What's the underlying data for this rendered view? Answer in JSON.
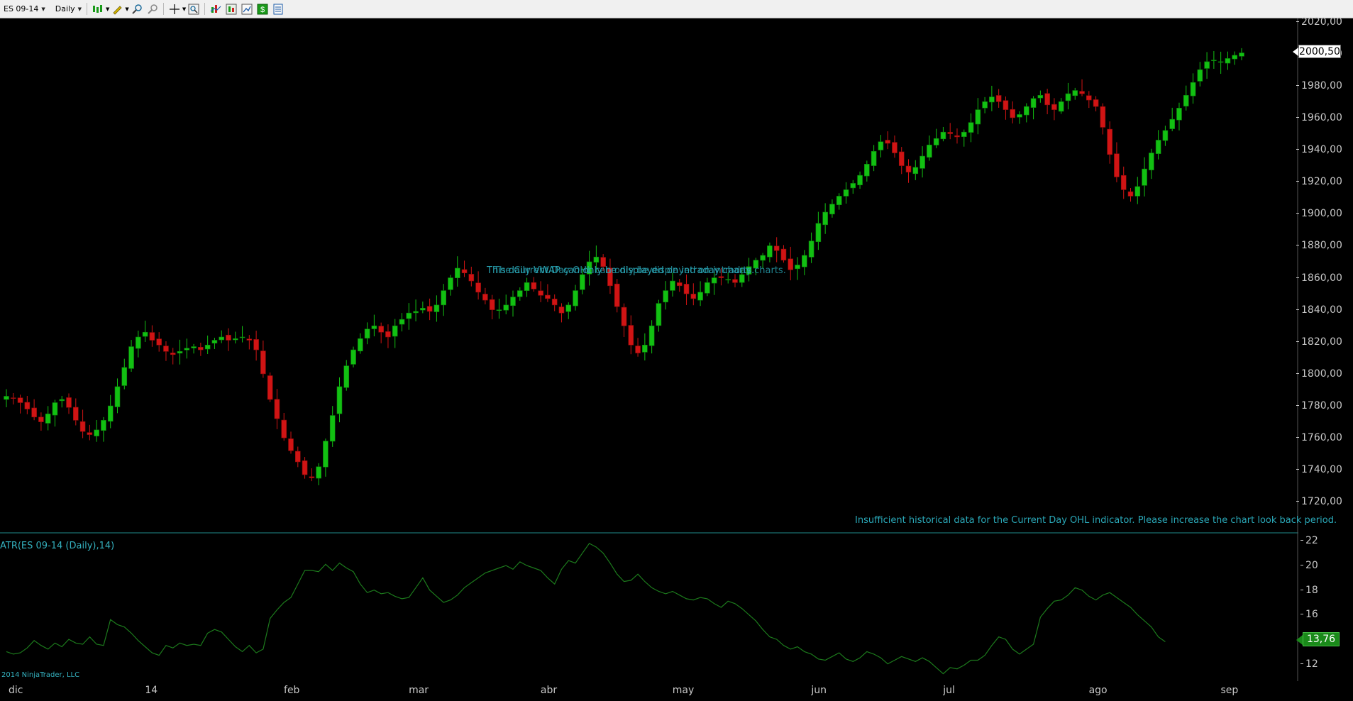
{
  "toolbar": {
    "instrument": "ES 09-14",
    "period": "Daily",
    "icons": [
      "bar-type-icon",
      "draw-pencil-icon",
      "zoom-in-icon",
      "zoom-out-icon",
      "crosshair-icon",
      "magnifier-icon",
      "indicators-icon",
      "strategies-icon",
      "chart-properties-icon",
      "dollar-icon",
      "data-box-icon"
    ]
  },
  "colors": {
    "background": "#000000",
    "up_candle": "#12c012",
    "down_candle": "#d01414",
    "atr_line": "#1c7a1c",
    "panel_divider": "#1f8a8a",
    "message_text": "#2aa8b8"
  },
  "price_panel": {
    "messages": {
      "vwap": "This daily VWAP can only be displayed on intraday charts.",
      "vwap_overlap": "The Current Day OHL can only be displayed on intraday charts.",
      "ohl": "Insufficient historical data for the Current Day OHL indicator. Please increase the chart look back period."
    },
    "last_price_label": "2000,50"
  },
  "indicator_panel": {
    "title": "ATR(ES 09-14 (Daily),14)",
    "last_value_label": "13,76"
  },
  "footer": {
    "copyright": "2014 NinjaTrader, LLC"
  },
  "chart_data": [
    {
      "type": "candlestick",
      "y_ticks": [
        "2020,00",
        "2000,00",
        "1980,00",
        "1960,00",
        "1940,00",
        "1920,00",
        "1900,00",
        "1880,00",
        "1860,00",
        "1840,00",
        "1820,00",
        "1800,00",
        "1780,00",
        "1760,00",
        "1740,00",
        "1720,00"
      ],
      "y_tick_values": [
        2020,
        2000,
        1980,
        1960,
        1940,
        1920,
        1900,
        1880,
        1860,
        1840,
        1820,
        1800,
        1780,
        1760,
        1740,
        1720
      ],
      "ylim": [
        1702,
        2022
      ],
      "x_tick_labels": [
        "dic",
        "14",
        "feb",
        "mar",
        "abr",
        "may",
        "jun",
        "jul",
        "ago",
        "sep"
      ],
      "x_tick_bar_index": [
        0,
        21,
        41,
        59,
        78,
        97,
        117,
        136,
        157,
        176
      ],
      "close_series": [
        1786,
        1785,
        1782,
        1778,
        1773,
        1770,
        1775,
        1782,
        1784,
        1779,
        1771,
        1764,
        1762,
        1765,
        1771,
        1780,
        1792,
        1804,
        1817,
        1823,
        1826,
        1821,
        1818,
        1814,
        1812,
        1814,
        1816,
        1817,
        1815,
        1818,
        1821,
        1823,
        1821,
        1822,
        1823,
        1821,
        1815,
        1800,
        1784,
        1772,
        1760,
        1752,
        1745,
        1737,
        1735,
        1742,
        1758,
        1774,
        1792,
        1805,
        1815,
        1822,
        1828,
        1830,
        1826,
        1823,
        1830,
        1834,
        1838,
        1839,
        1841,
        1839,
        1843,
        1852,
        1860,
        1866,
        1863,
        1858,
        1851,
        1846,
        1840,
        1840,
        1843,
        1848,
        1852,
        1857,
        1853,
        1849,
        1847,
        1843,
        1838,
        1843,
        1852,
        1862,
        1870,
        1873,
        1867,
        1855,
        1842,
        1830,
        1818,
        1813,
        1818,
        1830,
        1844,
        1852,
        1858,
        1855,
        1850,
        1847,
        1851,
        1857,
        1860,
        1860,
        1859,
        1857,
        1862,
        1867,
        1871,
        1874,
        1880,
        1877,
        1871,
        1865,
        1868,
        1874,
        1883,
        1894,
        1901,
        1906,
        1911,
        1915,
        1919,
        1924,
        1931,
        1939,
        1945,
        1944,
        1938,
        1930,
        1926,
        1929,
        1936,
        1943,
        1947,
        1951,
        1950,
        1948,
        1951,
        1957,
        1965,
        1970,
        1973,
        1970,
        1965,
        1960,
        1962,
        1967,
        1972,
        1974,
        1968,
        1965,
        1970,
        1975,
        1977,
        1975,
        1971,
        1967,
        1954,
        1937,
        1923,
        1915,
        1911,
        1917,
        1928,
        1938,
        1946,
        1952,
        1959,
        1966,
        1974,
        1982,
        1990,
        1995,
        1996,
        1995,
        1997,
        1999,
        2000.5
      ]
    },
    {
      "type": "line",
      "series": [
        {
          "name": "ATR(ES 09-14 (Daily),14)",
          "values": [
            13.0,
            12.8,
            12.9,
            13.3,
            13.9,
            13.5,
            13.2,
            13.7,
            13.4,
            14.0,
            13.7,
            13.6,
            14.2,
            13.6,
            13.5,
            15.6,
            15.2,
            15.0,
            14.5,
            13.9,
            13.4,
            12.9,
            12.7,
            13.5,
            13.3,
            13.7,
            13.5,
            13.6,
            13.5,
            14.5,
            14.8,
            14.6,
            14.0,
            13.4,
            13.0,
            13.5,
            12.9,
            13.2,
            15.7,
            16.4,
            17.0,
            17.4,
            18.5,
            19.6,
            19.6,
            19.5,
            20.1,
            19.6,
            20.2,
            19.8,
            19.5,
            18.5,
            17.8,
            18.0,
            17.7,
            17.8,
            17.5,
            17.3,
            17.4,
            18.2,
            19.0,
            18.0,
            17.5,
            17.0,
            17.2,
            17.6,
            18.2,
            18.6,
            19.0,
            19.4,
            19.6,
            19.8,
            20.0,
            19.7,
            20.3,
            20.0,
            19.8,
            19.6,
            19.0,
            18.5,
            19.7,
            20.4,
            20.2,
            21.0,
            21.8,
            21.5,
            21.0,
            20.2,
            19.3,
            18.7,
            18.8,
            19.3,
            18.7,
            18.2,
            17.9,
            17.7,
            17.9,
            17.6,
            17.3,
            17.2,
            17.4,
            17.3,
            16.9,
            16.6,
            17.1,
            16.9,
            16.5,
            16.0,
            15.5,
            14.8,
            14.2,
            14.0,
            13.5,
            13.2,
            13.4,
            13.0,
            12.8,
            12.4,
            12.3,
            12.6,
            12.9,
            12.4,
            12.2,
            12.5,
            13.0,
            12.8,
            12.5,
            12.0,
            12.3,
            12.6,
            12.4,
            12.2,
            12.5,
            12.2,
            11.7,
            11.2,
            11.7,
            11.6,
            11.9,
            12.3,
            12.3,
            12.7,
            13.5,
            14.2,
            14.0,
            13.2,
            12.8,
            13.2,
            13.6,
            15.8,
            16.5,
            17.1,
            17.2,
            17.6,
            18.2,
            18.0,
            17.5,
            17.2,
            17.6,
            17.8,
            17.4,
            17.0,
            16.6,
            16.0,
            15.5,
            15.0,
            14.2,
            13.8
          ]
        }
      ],
      "y_ticks": [
        "22",
        "20",
        "18",
        "16",
        "12"
      ],
      "y_tick_values": [
        22,
        20,
        18,
        16,
        12
      ],
      "ylim": [
        10.6,
        22.6
      ]
    }
  ]
}
